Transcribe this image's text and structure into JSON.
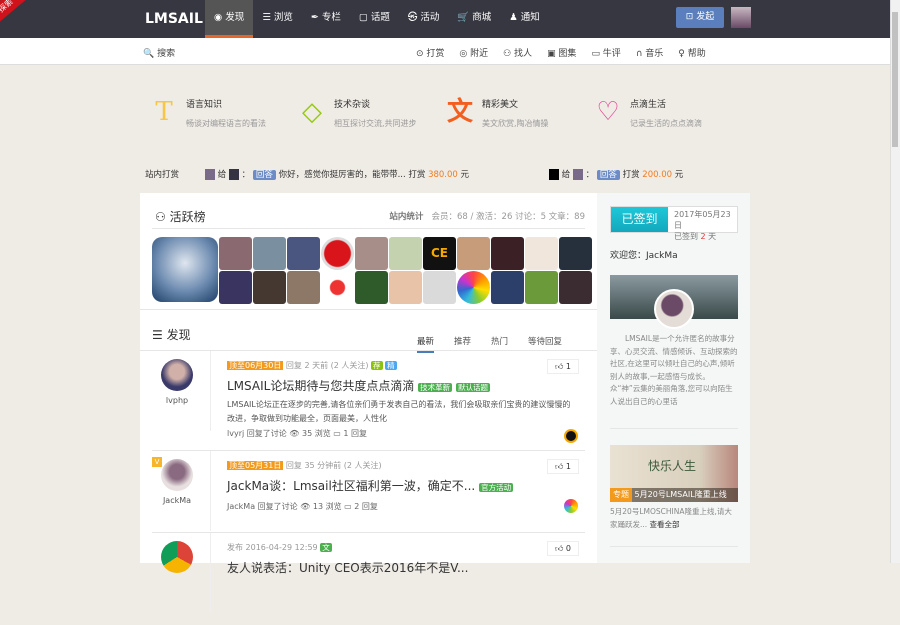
{
  "header": {
    "ribbon": "探索",
    "logo": "LMSAIL",
    "nav": [
      "◉ 发现",
      "☰ 浏览",
      "✒ 专栏",
      "▢ 话题",
      "㉿ 活动",
      "🛒 商城",
      "♟ 通知"
    ],
    "post_button": "⊡ 发起"
  },
  "subbar": {
    "search": "🔍 搜索",
    "links": [
      "⊙ 打赏",
      "◎ 附近",
      "⚇ 找人",
      "▣ 图集",
      "▭ 牛评",
      "∩ 音乐",
      "♀ 帮助"
    ]
  },
  "categories": [
    {
      "icon": "T",
      "color": "#f7c744",
      "title": "语言知识",
      "desc": "畅谈对编程语言的看法"
    },
    {
      "icon": "◇",
      "color": "#93c90f",
      "title": "技术杂谈",
      "desc": "相互探讨交流,共同进步"
    },
    {
      "icon": "文",
      "color": "#f25f1e",
      "title": "精彩美文",
      "desc": "美文欣赏,陶冶情操"
    },
    {
      "icon": "♡",
      "color": "#e2408e",
      "title": "点滴生活",
      "desc": "记录生活的点点滴滴"
    }
  ],
  "reward": {
    "label": "站内打赏",
    "items": [
      {
        "give": "给",
        "sep": "：",
        "tag": "回答",
        "text": "你好，感觉你挺厉害的，能带带... 打赏",
        "amount": "380.00",
        "unit": "元"
      },
      {
        "give": "给",
        "sep": "：",
        "tag": "回答",
        "text": "打赏",
        "amount": "200.00",
        "unit": "元"
      }
    ]
  },
  "active": {
    "title": "活跃榜",
    "stats_label": "站内统计",
    "stats": "会员：68 / 激活：26   讨论：5   文章：89"
  },
  "discover": {
    "title": "发现",
    "tabs": [
      "最新",
      "推荐",
      "热门",
      "等待回复"
    ]
  },
  "posts": [
    {
      "user": "lvphp",
      "pin": "顶至06月30日",
      "meta": "回复 2 天前 (2 人关注)",
      "badges": [
        "荐",
        "精"
      ],
      "title": "LMSAIL论坛期待与您共度点点滴滴",
      "labels": [
        "技术革新",
        "默认话题"
      ],
      "desc": "LMSAIL论坛正在逐步的完善,请各位亲们勇于发表自己的看法，我们会吸取亲们宝贵的建议慢慢的改进，争取做到功能最全，页面最美，人性化",
      "foot": "lvyrj 回复了讨论   👁 35 浏览   ▭ 1 回复",
      "likes": "1"
    },
    {
      "user": "JackMa",
      "pin": "顶至05月31日",
      "meta": "回复 35 分钟前 (2 人关注)",
      "badges": [],
      "title": "JackMa谈：Lmsail社区福利第一波，确定不...",
      "labels": [
        "官方活动"
      ],
      "foot": "JackMa 回复了讨论   👁 13 浏览   ▭ 2 回复",
      "likes": "1"
    },
    {
      "meta": "发布 2016-04-29 12:59",
      "badges": [
        "文"
      ],
      "title": "友人说表活：Unity CEO表示2016年不是V...",
      "likes": "0"
    }
  ],
  "sidebar": {
    "checkin": "已签到",
    "date": "2017年05月23日",
    "days_prefix": "已签到 ",
    "days": "2",
    "days_suffix": " 天",
    "welcome": "欢迎您：JackMa",
    "about": "LMSAIL是一个允许匿名的故事分享、心灵交流、情感倾诉、互动探索的社区,在这里可以倾吐自己的心声,倾听别人的故事,一起感悟与成长。众“神”云集的美丽角落,您可以向陌生人说出自己的心里话",
    "banner_text": "快乐人生",
    "special_tag": "专题",
    "special_title": "5月20号LMSAIL隆重上线",
    "special_desc": "5月20号LMOSCHINA隆重上线,请大家踊跃发...",
    "more": "查看全部"
  }
}
